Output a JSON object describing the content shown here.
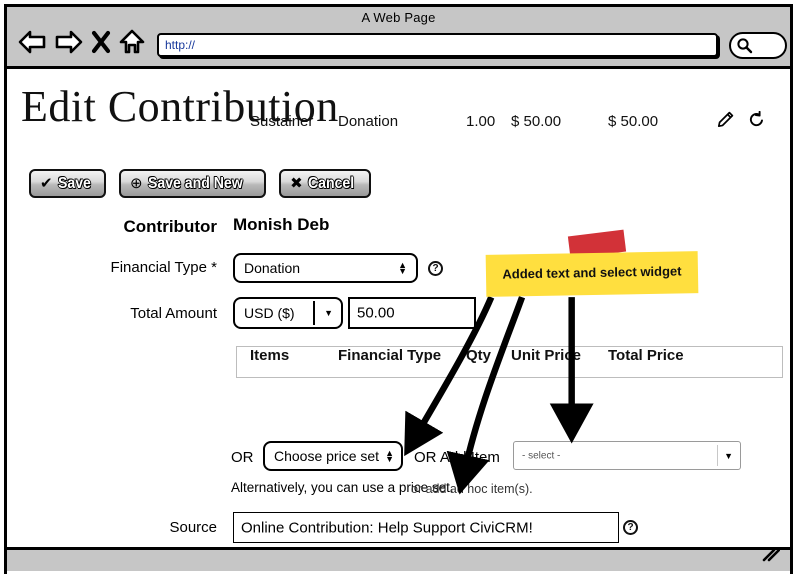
{
  "browser": {
    "window_title": "A Web Page",
    "url_value": "http://",
    "nav": [
      {
        "name": "back-icon",
        "label": "Back"
      },
      {
        "name": "forward-icon",
        "label": "Forward"
      },
      {
        "name": "stop-icon",
        "label": "Stop"
      },
      {
        "name": "home-icon",
        "label": "Home"
      }
    ],
    "search_icon": "search-icon"
  },
  "page": {
    "title": "Edit Contribution",
    "buttons": [
      {
        "icon": "check-icon",
        "glyph": "✔",
        "label": "Save"
      },
      {
        "icon": "plus-circle-icon",
        "glyph": "⊕",
        "label": "Save and New"
      },
      {
        "icon": "x-box-icon",
        "glyph": "✖",
        "label": "Cancel"
      }
    ],
    "fields": {
      "contributor_label": "Contributor",
      "contributor_value": "Monish Deb",
      "financial_type_label": "Financial Type *",
      "financial_type_value": "Donation",
      "total_amount_label": "Total Amount",
      "currency_value": "USD ($)",
      "amount_value": "50.00",
      "source_label": "Source",
      "source_value": "Online Contribution: Help Support CiviCRM!",
      "help_glyph": "?"
    },
    "line_items": {
      "headers": [
        "Items",
        "Financial Type",
        "Qty",
        "Unit Price",
        "Total Price"
      ],
      "rows": [
        {
          "item": "Sustainer",
          "financial_type": "Donation",
          "qty": "1.00",
          "unit_price": "$ 50.00",
          "total_price": "$ 50.00",
          "edit_icon": "pencil-icon",
          "reset_icon": "undo-icon"
        }
      ]
    },
    "price_row": {
      "or_label": "OR",
      "choose_price_set": "Choose price set",
      "or_add_item_label": "OR Add Item",
      "add_item_select_value": "- select -",
      "hint_primary": "Alternatively, you can use a price set.",
      "hint_secondary": "or add ad hoc item(s)."
    }
  },
  "annotation": {
    "sticky_text": "Added text and select widget",
    "sticky_color": "#ffdf3f",
    "tape_color": "#cf2229",
    "arrow_count": 3
  }
}
